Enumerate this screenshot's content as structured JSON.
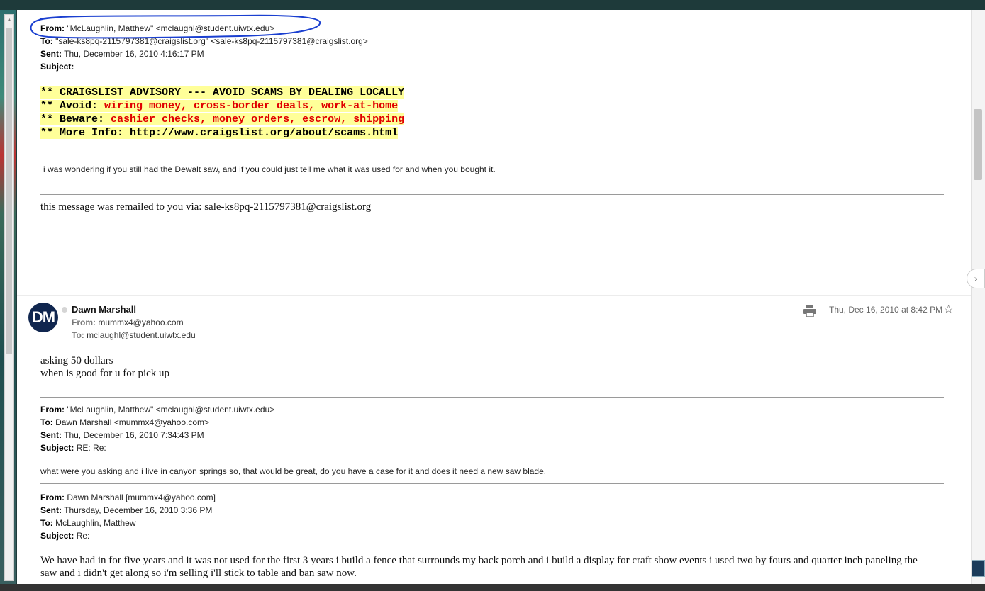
{
  "first_message": {
    "from_label": "From:",
    "from_value": "\"McLaughlin, Matthew\" <mclaughl@student.uiwtx.edu>",
    "to_label": "To:",
    "to_value": "\"sale-ks8pq-2115797381@craigslist.org\" <sale-ks8pq-2115797381@craigslist.org>",
    "sent_label": "Sent:",
    "sent_value": "Thu, December 16, 2010 4:16:17 PM",
    "subject_label": "Subject:",
    "subject_value": "",
    "advisory": {
      "line1": "** CRAIGSLIST ADVISORY --- AVOID SCAMS BY DEALING LOCALLY",
      "line2_prefix": "** Avoid: ",
      "line2_red": "wiring money, cross-border deals, work-at-home",
      "line3_prefix": "** Beware: ",
      "line3_red": "cashier checks, money orders, escrow, shipping",
      "line4": "** More Info: http://www.craigslist.org/about/scams.html"
    },
    "body": "i was wondering if you still had the Dewalt saw, and if you could just tell me what it was used for and when you bought it.",
    "remail_note": "this message was remailed to you via: sale-ks8pq-2115797381@craigslist.org"
  },
  "second_message": {
    "avatar_initials": "DM",
    "sender_name": "Dawn Marshall",
    "from_label": "From:",
    "from_value": "mummx4@yahoo.com",
    "to_label": "To:",
    "to_value": "mclaughl@student.uiwtx.edu",
    "date": "Thu, Dec 16, 2010 at 8:42 PM",
    "reply_line1": "asking 50 dollars",
    "reply_line2": "when is good for u for pick up",
    "quoted1": {
      "from_label": "From:",
      "from_value": "\"McLaughlin, Matthew\" <mclaughl@student.uiwtx.edu>",
      "to_label": "To:",
      "to_value": "Dawn Marshall <mummx4@yahoo.com>",
      "sent_label": "Sent:",
      "sent_value": "Thu, December 16, 2010 7:34:43 PM",
      "subject_label": "Subject:",
      "subject_value": "RE: Re:",
      "body": "what were you asking and i live in canyon springs so, that would be great, do you have a case for it and does it need a new saw blade."
    },
    "quoted2": {
      "from_label": "From:",
      "from_value": "Dawn Marshall [mummx4@yahoo.com]",
      "sent_label": "Sent:",
      "sent_value": "Thursday, December 16, 2010 3:36 PM",
      "to_label": "To:",
      "to_value": "McLaughlin, Matthew",
      "subject_label": "Subject:",
      "subject_value": "Re:",
      "body": "We have had in for five years and it was not used for the first 3 years i build a fence that surrounds my back porch and i build a display for craft show events i used two by fours and quarter inch paneling the saw and i didn't get along so i'm selling i'll stick to table and ban saw now."
    }
  },
  "icons": {
    "print": "print-icon",
    "star": "star-icon",
    "next": "chevron-right-icon"
  },
  "colors": {
    "advisory_highlight": "#ffff99",
    "advisory_red": "#e00000",
    "avatar_bg": "#10264f",
    "annotation_circle": "#1a3fd0"
  }
}
